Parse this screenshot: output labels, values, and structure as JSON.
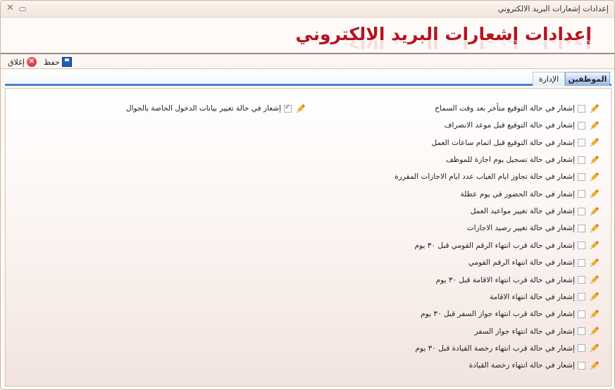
{
  "window": {
    "title": "إعدادات إشعارات البريد الالكتروني"
  },
  "banner": {
    "heading": "إعدادات إشعارات البريد الالكتروني"
  },
  "toolbar": {
    "save_label": "حفظ",
    "close_label": "إغلاق"
  },
  "tabs": [
    {
      "label": "الموظفين",
      "active": true
    },
    {
      "label": "الإدارة",
      "active": false
    }
  ],
  "options_right": [
    {
      "label": "إشعار في حالة التوقيع متأخر بعد وقت السماح",
      "checked": false
    },
    {
      "label": "إشعار في حالة التوقيع قبل موعد الانصراف",
      "checked": false
    },
    {
      "label": "إشعار في حالة التوقيع قبل اتمام ساعات العمل",
      "checked": false
    },
    {
      "label": "إشعار في حالة تسجيل يوم اجازة للموظف",
      "checked": false
    },
    {
      "label": "إشعار في حالة تجاوز ايام الغياب عدد ايام الاجازات المقررة",
      "checked": false
    },
    {
      "label": "إشعار في حالة الحضور في يوم عطلة",
      "checked": false
    },
    {
      "label": "إشعار في حالة تغيير مواعيد العمل",
      "checked": false
    },
    {
      "label": "إشعار في حالة تغيير رصيد الاجازات",
      "checked": false
    },
    {
      "label": "إشعار في حالة قرب انتهاء الرقم القومي قبل ٣٠ يوم",
      "checked": false
    },
    {
      "label": "إشعار في حالة انتهاء الرقم القومي",
      "checked": false
    },
    {
      "label": "إشعار في حالة قرب انتهاء الاقامة قبل ٣٠ يوم",
      "checked": false
    },
    {
      "label": "إشعار في حالة انتهاء الاقامة",
      "checked": false
    },
    {
      "label": "إشعار في حالة قرب انتهاء جواز السفر قبل ٣٠ يوم",
      "checked": false
    },
    {
      "label": "إشعار في حالة انتهاء جواز السفر",
      "checked": false
    },
    {
      "label": "إشعار في حالة قرب انتهاء رخصة القيادة قبل ٣٠ يوم",
      "checked": false
    },
    {
      "label": "إشعار في حالة انتهاء رخصة القيادة",
      "checked": false
    }
  ],
  "options_left": [
    {
      "label": "إشعار في حالة تغيير بيانات الدخول الخاصة بالجوال",
      "checked": true
    }
  ],
  "icons": {
    "edit": "pencil-icon",
    "save": "floppy-disk-icon",
    "close": "red-x-circle-icon",
    "window_close": "x-icon",
    "window_minimize": "minimize-icon"
  },
  "colors": {
    "banner_text": "#b51420",
    "tab_accent": "#4a82c6"
  }
}
